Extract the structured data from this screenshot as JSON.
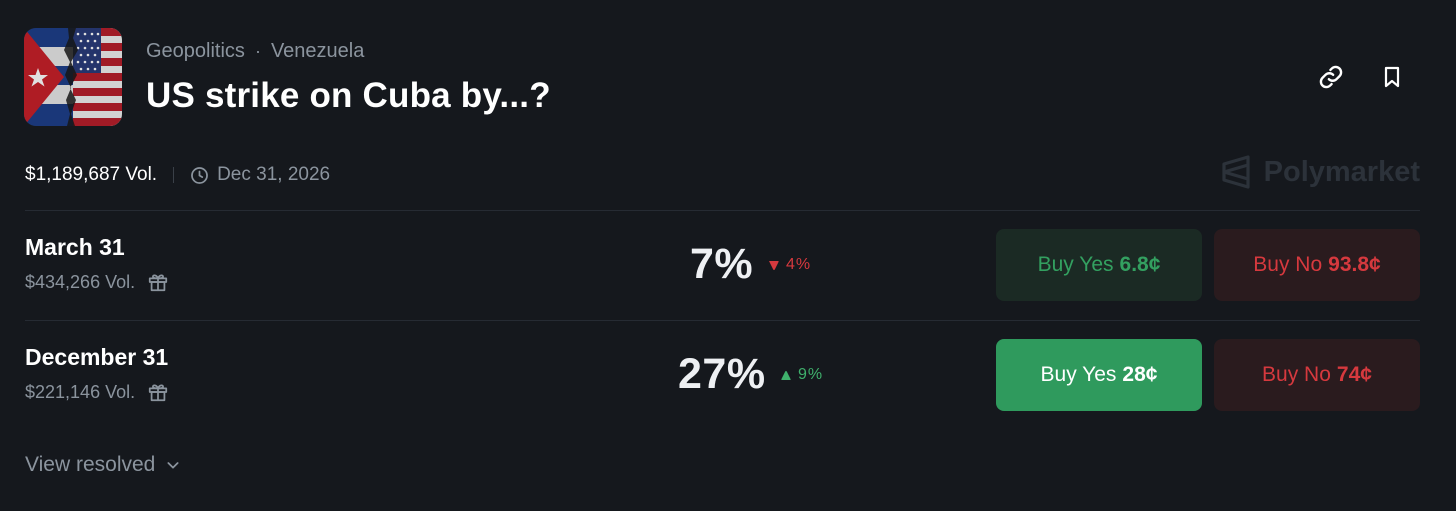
{
  "header": {
    "breadcrumb": [
      "Geopolitics",
      "Venezuela"
    ],
    "separator": "·",
    "title": "US strike on Cuba by...?"
  },
  "meta": {
    "volume": "$1,189,687 Vol.",
    "end_date": "Dec 31, 2026"
  },
  "brand": {
    "name": "Polymarket",
    "icon": "polymarket-logo-icon"
  },
  "actions": {
    "link_icon": "link-icon",
    "bookmark_icon": "bookmark-icon"
  },
  "markets": [
    {
      "name": "March 31",
      "volume": "$434,266 Vol.",
      "probability": "7%",
      "change": "4%",
      "change_direction": "down",
      "buy_yes_label": "Buy Yes",
      "buy_yes_price": "6.8¢",
      "buy_no_label": "Buy No",
      "buy_no_price": "93.8¢"
    },
    {
      "name": "December 31",
      "volume": "$221,146 Vol.",
      "probability": "27%",
      "change": "9%",
      "change_direction": "up",
      "buy_yes_label": "Buy Yes",
      "buy_yes_price": "28¢",
      "buy_no_label": "Buy No",
      "buy_no_price": "74¢"
    }
  ],
  "footer": {
    "view_resolved": "View resolved"
  },
  "colors": {
    "background": "#15181d",
    "yes_green": "#2f9a5d",
    "no_red": "#d6393e",
    "muted_text": "#8b949e"
  }
}
